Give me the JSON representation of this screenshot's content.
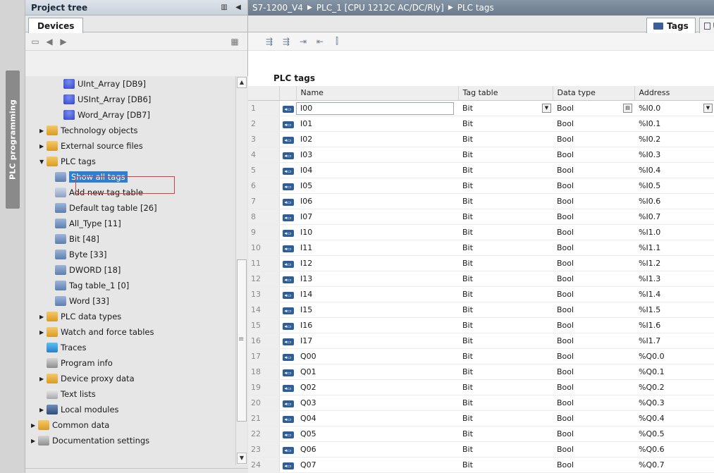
{
  "sidebar_tab": {
    "label": "PLC programming"
  },
  "project_tree": {
    "title": "Project tree",
    "devices_tab": "Devices",
    "items": [
      {
        "label": "UInt_Array [DB9]",
        "indent": 3,
        "arrow": "",
        "icon": "db"
      },
      {
        "label": "USInt_Array [DB6]",
        "indent": 3,
        "arrow": "",
        "icon": "db"
      },
      {
        "label": "Word_Array [DB7]",
        "indent": 3,
        "arrow": "",
        "icon": "db"
      },
      {
        "label": "Technology objects",
        "indent": 1,
        "arrow": "▶",
        "icon": "tech"
      },
      {
        "label": "External source files",
        "indent": 1,
        "arrow": "▶",
        "icon": "folder"
      },
      {
        "label": "PLC tags",
        "indent": 1,
        "arrow": "▼",
        "icon": "folder"
      },
      {
        "label": "Show all tags",
        "indent": 2,
        "arrow": "",
        "icon": "tag",
        "selected": true
      },
      {
        "label": "Add new tag table",
        "indent": 2,
        "arrow": "",
        "icon": "add"
      },
      {
        "label": "Default tag table [26]",
        "indent": 2,
        "arrow": "",
        "icon": "tag"
      },
      {
        "label": "All_Type [11]",
        "indent": 2,
        "arrow": "",
        "icon": "tag"
      },
      {
        "label": "Bit [48]",
        "indent": 2,
        "arrow": "",
        "icon": "tag"
      },
      {
        "label": "Byte [33]",
        "indent": 2,
        "arrow": "",
        "icon": "tag"
      },
      {
        "label": "DWORD [18]",
        "indent": 2,
        "arrow": "",
        "icon": "tag"
      },
      {
        "label": "Tag table_1 [0]",
        "indent": 2,
        "arrow": "",
        "icon": "tag"
      },
      {
        "label": "Word [33]",
        "indent": 2,
        "arrow": "",
        "icon": "tag"
      },
      {
        "label": "PLC data types",
        "indent": 1,
        "arrow": "▶",
        "icon": "folder"
      },
      {
        "label": "Watch and force tables",
        "indent": 1,
        "arrow": "▶",
        "icon": "folder"
      },
      {
        "label": "Traces",
        "indent": 1,
        "arrow": "",
        "icon": "trace"
      },
      {
        "label": "Program info",
        "indent": 1,
        "arrow": "",
        "icon": "info"
      },
      {
        "label": "Device proxy data",
        "indent": 1,
        "arrow": "▶",
        "icon": "folder"
      },
      {
        "label": "Text lists",
        "indent": 1,
        "arrow": "",
        "icon": "text"
      },
      {
        "label": "Local modules",
        "indent": 1,
        "arrow": "▶",
        "icon": "local"
      },
      {
        "label": "Common data",
        "indent": 0,
        "arrow": "▶",
        "icon": "common"
      },
      {
        "label": "Documentation settings",
        "indent": 0,
        "arrow": "▶",
        "icon": "info"
      }
    ]
  },
  "breadcrumb": [
    "S7-1200_V4",
    "PLC_1 [CPU 1212C AC/DC/Rly]",
    "PLC tags"
  ],
  "tabs": {
    "tags": "Tags",
    "user": "U"
  },
  "table": {
    "title": "PLC tags",
    "columns": [
      "Name",
      "Tag table",
      "Data type",
      "Address"
    ],
    "rows": [
      {
        "num": "1",
        "name": "I00",
        "table": "Bit",
        "type": "Bool",
        "address": "%I0.0"
      },
      {
        "num": "2",
        "name": "I01",
        "table": "Bit",
        "type": "Bool",
        "address": "%I0.1"
      },
      {
        "num": "3",
        "name": "I02",
        "table": "Bit",
        "type": "Bool",
        "address": "%I0.2"
      },
      {
        "num": "4",
        "name": "I03",
        "table": "Bit",
        "type": "Bool",
        "address": "%I0.3"
      },
      {
        "num": "5",
        "name": "I04",
        "table": "Bit",
        "type": "Bool",
        "address": "%I0.4"
      },
      {
        "num": "6",
        "name": "I05",
        "table": "Bit",
        "type": "Bool",
        "address": "%I0.5"
      },
      {
        "num": "7",
        "name": "I06",
        "table": "Bit",
        "type": "Bool",
        "address": "%I0.6"
      },
      {
        "num": "8",
        "name": "I07",
        "table": "Bit",
        "type": "Bool",
        "address": "%I0.7"
      },
      {
        "num": "9",
        "name": "I10",
        "table": "Bit",
        "type": "Bool",
        "address": "%I1.0"
      },
      {
        "num": "10",
        "name": "I11",
        "table": "Bit",
        "type": "Bool",
        "address": "%I1.1"
      },
      {
        "num": "11",
        "name": "I12",
        "table": "Bit",
        "type": "Bool",
        "address": "%I1.2"
      },
      {
        "num": "12",
        "name": "I13",
        "table": "Bit",
        "type": "Bool",
        "address": "%I1.3"
      },
      {
        "num": "13",
        "name": "I14",
        "table": "Bit",
        "type": "Bool",
        "address": "%I1.4"
      },
      {
        "num": "14",
        "name": "I15",
        "table": "Bit",
        "type": "Bool",
        "address": "%I1.5"
      },
      {
        "num": "15",
        "name": "I16",
        "table": "Bit",
        "type": "Bool",
        "address": "%I1.6"
      },
      {
        "num": "16",
        "name": "I17",
        "table": "Bit",
        "type": "Bool",
        "address": "%I1.7"
      },
      {
        "num": "17",
        "name": "Q00",
        "table": "Bit",
        "type": "Bool",
        "address": "%Q0.0"
      },
      {
        "num": "18",
        "name": "Q01",
        "table": "Bit",
        "type": "Bool",
        "address": "%Q0.1"
      },
      {
        "num": "19",
        "name": "Q02",
        "table": "Bit",
        "type": "Bool",
        "address": "%Q0.2"
      },
      {
        "num": "20",
        "name": "Q03",
        "table": "Bit",
        "type": "Bool",
        "address": "%Q0.3"
      },
      {
        "num": "21",
        "name": "Q04",
        "table": "Bit",
        "type": "Bool",
        "address": "%Q0.4"
      },
      {
        "num": "22",
        "name": "Q05",
        "table": "Bit",
        "type": "Bool",
        "address": "%Q0.5"
      },
      {
        "num": "23",
        "name": "Q06",
        "table": "Bit",
        "type": "Bool",
        "address": "%Q0.6"
      },
      {
        "num": "24",
        "name": "Q07",
        "table": "Bit",
        "type": "Bool",
        "address": "%Q0.7"
      }
    ]
  },
  "colors": {
    "selection": "#2d7fd3",
    "highlight_border": "#e03a3a",
    "tag_icon": "#2f5d96"
  }
}
